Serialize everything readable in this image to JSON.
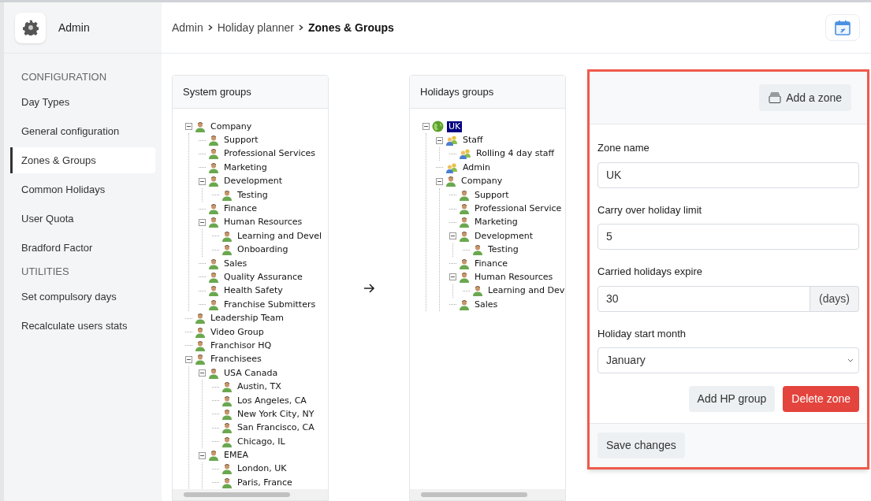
{
  "sidebar": {
    "title": "Admin",
    "sections": [
      {
        "heading": "CONFIGURATION",
        "items": [
          {
            "label": "Day Types",
            "selected": false
          },
          {
            "label": "General configuration",
            "selected": false
          },
          {
            "label": "Zones & Groups",
            "selected": true
          },
          {
            "label": "Common Holidays",
            "selected": false
          },
          {
            "label": "User Quota",
            "selected": false
          },
          {
            "label": "Bradford Factor",
            "selected": false
          }
        ]
      },
      {
        "heading": "UTILITIES",
        "items": [
          {
            "label": "Set compulsory days",
            "selected": false
          },
          {
            "label": "Recalculate users stats",
            "selected": false
          }
        ]
      }
    ]
  },
  "breadcrumb": [
    {
      "label": "Admin",
      "current": false
    },
    {
      "label": "Holiday planner",
      "current": false
    },
    {
      "label": "Zones & Groups",
      "current": true
    }
  ],
  "system_groups": {
    "title": "System groups",
    "tree": [
      {
        "label": "Company",
        "kind": "user",
        "selected": false,
        "expanded": true,
        "children": [
          {
            "label": "Support",
            "kind": "user",
            "selected": false
          },
          {
            "label": "Professional Services",
            "kind": "user",
            "selected": false
          },
          {
            "label": "Marketing",
            "kind": "user",
            "selected": false
          },
          {
            "label": "Development",
            "kind": "user",
            "selected": false,
            "expanded": true,
            "children": [
              {
                "label": "Testing",
                "kind": "user",
                "selected": false
              }
            ]
          },
          {
            "label": "Finance",
            "kind": "user",
            "selected": false
          },
          {
            "label": "Human Resources",
            "kind": "user",
            "selected": false,
            "expanded": true,
            "children": [
              {
                "label": "Learning and Devel",
                "kind": "user",
                "selected": false
              },
              {
                "label": "Onboarding",
                "kind": "user",
                "selected": false
              }
            ]
          },
          {
            "label": "Sales",
            "kind": "user",
            "selected": false
          },
          {
            "label": "Quality Assurance",
            "kind": "user",
            "selected": false
          },
          {
            "label": "Health Safety",
            "kind": "user",
            "selected": false
          },
          {
            "label": "Franchise Submitters",
            "kind": "user",
            "selected": false
          }
        ]
      },
      {
        "label": "Leadership Team",
        "kind": "user",
        "selected": false
      },
      {
        "label": "Video Group",
        "kind": "user",
        "selected": false
      },
      {
        "label": "Franchisor HQ",
        "kind": "user",
        "selected": false
      },
      {
        "label": "Franchisees",
        "kind": "user",
        "selected": false,
        "expanded": true,
        "children": [
          {
            "label": "USA Canada",
            "kind": "user",
            "selected": false,
            "expanded": true,
            "children": [
              {
                "label": "Austin, TX",
                "kind": "user",
                "selected": false
              },
              {
                "label": "Los Angeles, CA",
                "kind": "user",
                "selected": false
              },
              {
                "label": "New York City, NY",
                "kind": "user",
                "selected": false
              },
              {
                "label": "San Francisco, CA",
                "kind": "user",
                "selected": false
              },
              {
                "label": "Chicago, IL",
                "kind": "user",
                "selected": false
              }
            ]
          },
          {
            "label": "EMEA",
            "kind": "user",
            "selected": false,
            "expanded": true,
            "children": [
              {
                "label": "London, UK",
                "kind": "user",
                "selected": false
              },
              {
                "label": "Paris, France",
                "kind": "user",
                "selected": false
              }
            ]
          }
        ]
      }
    ]
  },
  "holidays_groups": {
    "title": "Holidays groups",
    "tree": [
      {
        "label": "UK",
        "kind": "zone",
        "selected": true,
        "expanded": true,
        "children": [
          {
            "label": "Staff",
            "kind": "group",
            "selected": false,
            "expanded": true,
            "children": [
              {
                "label": "Rolling 4 day staff",
                "kind": "group",
                "selected": false
              }
            ]
          },
          {
            "label": "Admin",
            "kind": "group",
            "selected": false
          },
          {
            "label": "Company",
            "kind": "user",
            "selected": false,
            "expanded": true,
            "children": [
              {
                "label": "Support",
                "kind": "user",
                "selected": false
              },
              {
                "label": "Professional Service",
                "kind": "user",
                "selected": false
              },
              {
                "label": "Marketing",
                "kind": "user",
                "selected": false
              },
              {
                "label": "Development",
                "kind": "user",
                "selected": false,
                "expanded": true,
                "children": [
                  {
                    "label": "Testing",
                    "kind": "user",
                    "selected": false
                  }
                ]
              },
              {
                "label": "Finance",
                "kind": "user",
                "selected": false
              },
              {
                "label": "Human Resources",
                "kind": "user",
                "selected": false,
                "expanded": true,
                "children": [
                  {
                    "label": "Learning and Dev",
                    "kind": "user",
                    "selected": false
                  }
                ]
              },
              {
                "label": "Sales",
                "kind": "user",
                "selected": false
              }
            ]
          }
        ]
      }
    ]
  },
  "zone_form": {
    "add_zone_button": "Add a zone",
    "fields": [
      {
        "kind": "text",
        "label": "Zone name",
        "value": "UK"
      },
      {
        "kind": "text",
        "label": "Carry over holiday limit",
        "value": "5"
      },
      {
        "kind": "addon",
        "label": "Carried holidays expire",
        "value": "30",
        "addon": "(days)"
      },
      {
        "kind": "select",
        "label": "Holiday start month",
        "value": "January"
      }
    ],
    "add_group_button": "Add HP group",
    "delete_button": "Delete zone",
    "save_button": "Save changes"
  }
}
